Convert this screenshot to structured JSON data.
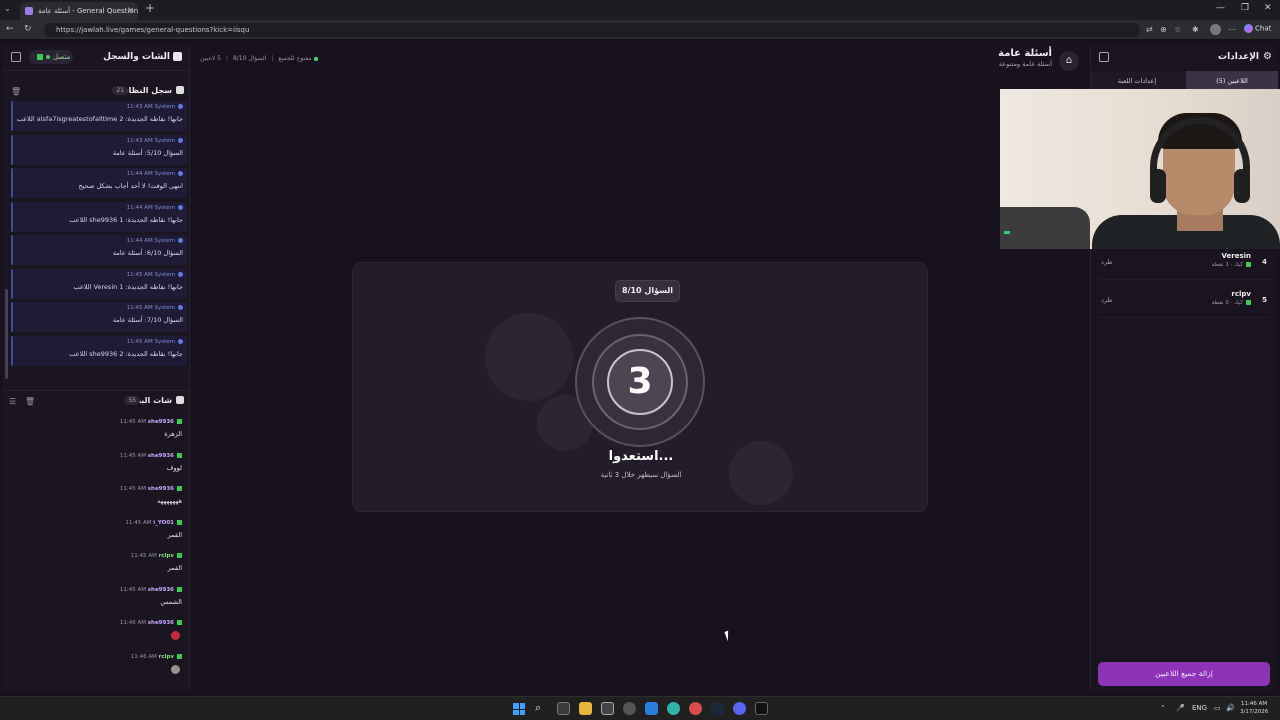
{
  "browser": {
    "tab_title": "أسئلة عامة - General Questions | ...",
    "url": "https://jawlah.live/games/general-questions?kick=iisqu",
    "chat_button": "Chat"
  },
  "left_panel": {
    "title": "الشات والسجل",
    "status_label": "متصل",
    "system_log": {
      "title": "سجل النظام",
      "count": "21",
      "entries": [
        {
          "sender": "System",
          "time": "11:43 AM",
          "message": "اللاعب alsfa7isgreatestofalltime جابها! نقاطه الجديدة: 2"
        },
        {
          "sender": "System",
          "time": "11:43 AM",
          "message": "السؤال 5/10: أسئلة عامة"
        },
        {
          "sender": "System",
          "time": "11:44 AM",
          "message": "انتهى الوقت! لا أحد أجاب بشكل صحيح"
        },
        {
          "sender": "System",
          "time": "11:44 AM",
          "message": "اللاعب she9936 جابها! نقاطه الجديدة: 1"
        },
        {
          "sender": "System",
          "time": "11:44 AM",
          "message": "السؤال 6/10: أسئلة عامة"
        },
        {
          "sender": "System",
          "time": "11:45 AM",
          "message": "اللاعب Veresin جابها! نقاطه الجديدة: 1"
        },
        {
          "sender": "System",
          "time": "11:45 AM",
          "message": "السؤال 7/10: أسئلة عامة"
        },
        {
          "sender": "System",
          "time": "11:45 AM",
          "message": "اللاعب she9936 جابها! نقاطه الجديدة: 2"
        }
      ]
    },
    "stream_chat": {
      "title": "شات البث",
      "count": "55",
      "messages": [
        {
          "user": "she9936",
          "time": "11:45 AM",
          "text": "الزهرة"
        },
        {
          "user": "she9936",
          "time": "11:45 AM",
          "text": "لووف"
        },
        {
          "user": "she9936",
          "time": "11:45 AM",
          "text": "هههههههه"
        },
        {
          "user": "i_YO01",
          "time": "11:45 AM",
          "text": "القمر"
        },
        {
          "user": "rclpv",
          "time": "11:45 AM",
          "text": "القمر"
        },
        {
          "user": "she9936",
          "time": "11:45 AM",
          "text": "الشمس"
        },
        {
          "user": "she9936",
          "time": "11:46 AM",
          "text": ""
        },
        {
          "user": "rclpv",
          "time": "11:46 AM",
          "text": ""
        }
      ]
    }
  },
  "top_status": {
    "players": "5 لاعبين",
    "question": "السؤال 8/10",
    "access": "مفتوح للجميع"
  },
  "game": {
    "title": "أسئلة عامة",
    "subtitle": "أسئلة عامة ومتنوعة"
  },
  "countdown": {
    "question_pill": "السؤال 8/10",
    "number": "3",
    "title": "استعدوا...",
    "subtitle": "السؤال سيظهر خلال 3 ثانية"
  },
  "right_panel": {
    "title": "الإعدادات",
    "tabs": [
      {
        "label": "اللاعبين (5)",
        "active": true
      },
      {
        "label": "إعدادات اللعبة",
        "active": false
      }
    ],
    "players": [
      {
        "rank": "4",
        "name": "Veresin",
        "sub": "كيك · 1 نقطة",
        "kick": "طرد"
      },
      {
        "rank": "5",
        "name": "rclpv",
        "sub": "كيك · 0 نقطة",
        "kick": "طرد"
      }
    ],
    "remove_all_label": "إزالة جميع اللاعبين"
  },
  "taskbar": {
    "lang": "ENG",
    "time": "11:46 AM",
    "date": "3/17/2026"
  },
  "colors": {
    "accent_purple": "#8c33b8",
    "kick_green": "#3dcc4e",
    "system_blue": "#3a4ea0"
  }
}
